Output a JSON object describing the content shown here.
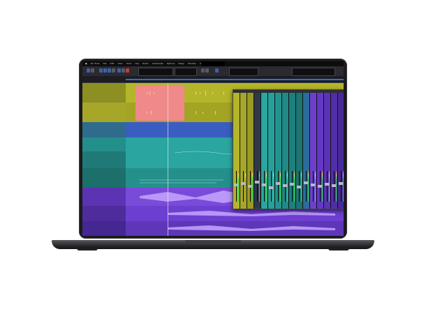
{
  "app": {
    "name": "Pro Tools",
    "menus": [
      "File",
      "Edit",
      "View",
      "Track",
      "Clip",
      "Event",
      "AudioSuite",
      "Options",
      "Setup",
      "Window",
      "Avid Link",
      "Help"
    ]
  },
  "colors": {
    "yellow_track": "#b4b52b",
    "pink_clip": "#f08a8a",
    "teal_track": "#2aa5a0",
    "purple_track": "#6d3fd0",
    "blue_accent": "#3f5fa8"
  },
  "icons": [
    "apple-icon",
    "play-icon",
    "stop-icon",
    "record-icon",
    "loop-icon"
  ],
  "device": "laptop"
}
